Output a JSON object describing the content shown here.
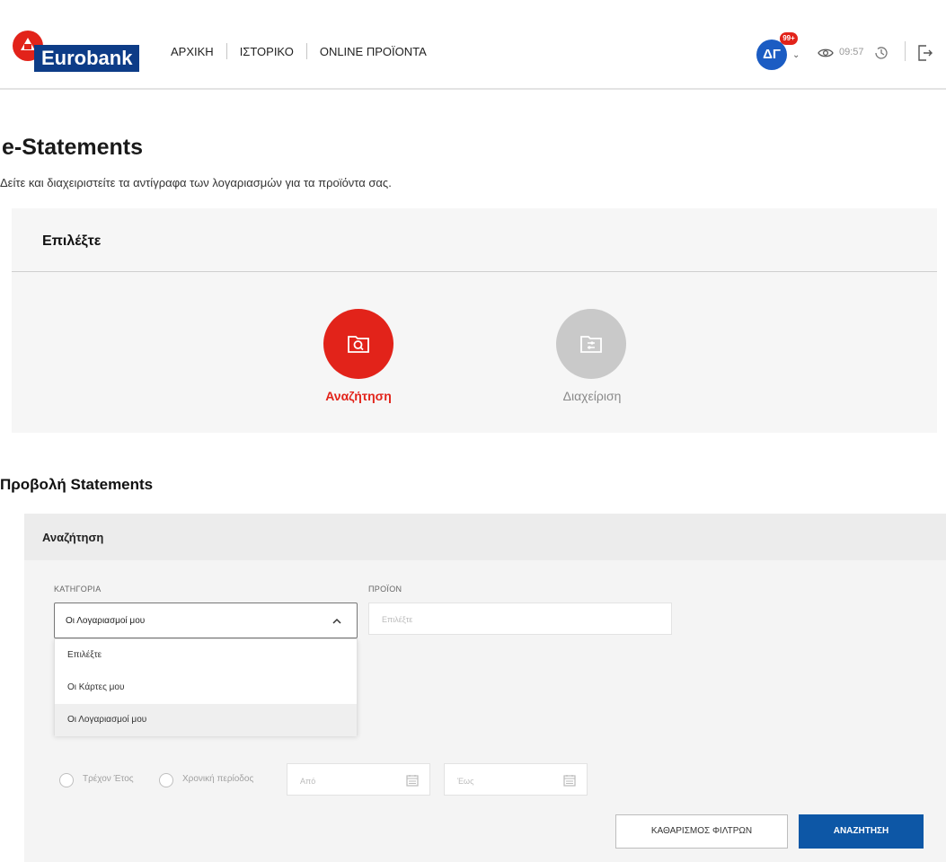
{
  "header": {
    "brand": "Eurobank",
    "nav": [
      "ΑΡΧΙΚΗ",
      "ΙΣΤΟΡΙΚΟ",
      "ONLINE ΠΡΟΪΟΝΤΑ"
    ],
    "avatar_initials": "ΔΓ",
    "notification_badge": "99+",
    "session_time": "09:57",
    "accent_color": "#e2231a",
    "brand_color": "#0d3c87"
  },
  "page": {
    "title": "e-Statements",
    "subtitle": "Δείτε και διαχειριστείτε τα αντίγραφα των λογαριασμών για τα προϊόντα σας."
  },
  "selector": {
    "title": "Επιλέξτε",
    "options": [
      {
        "label": "Αναζήτηση",
        "icon": "folder-search-icon",
        "active": true
      },
      {
        "label": "Διαχείριση",
        "icon": "folder-settings-icon",
        "active": false
      }
    ]
  },
  "statements": {
    "title": "Προβολή Statements",
    "search_header": "Αναζήτηση",
    "category_label": "ΚΑΤΗΓΟΡΙΑ",
    "category_value": "Οι Λογαριασμοί μου",
    "category_options": [
      "Επιλέξτε",
      "Οι Κάρτες μου",
      "Οι Λογαριασμοί μου"
    ],
    "product_label": "ΠΡΟΪΟΝ",
    "product_placeholder": "Επιλέξτε",
    "radio_current_year": "Τρέχον Έτος",
    "radio_period": "Χρονική περίοδος",
    "date_from_placeholder": "Από",
    "date_to_placeholder": "Έως",
    "clear_button": "ΚΑΘΑΡΙΣΜΟΣ ΦΙΛΤΡΩΝ",
    "search_button": "ΑΝΑΖΗΤΗΣΗ",
    "primary_button_color": "#0d57a6"
  }
}
